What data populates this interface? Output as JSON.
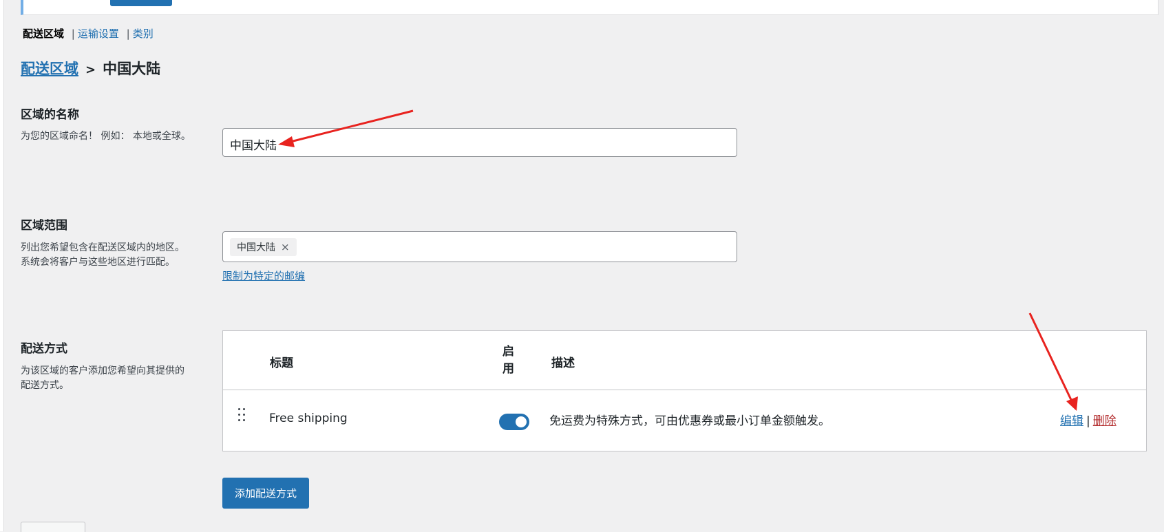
{
  "tabs": {
    "current": "配送区域",
    "separator": "|",
    "items": [
      "运输设置",
      "类别"
    ]
  },
  "breadcrumb": {
    "parent": "配送区域",
    "arrow": ">",
    "current": "中国大陆"
  },
  "zone_name": {
    "title": "区域的名称",
    "description": "为您的区域命名！ 例如： 本地或全球。",
    "value": "中国大陆"
  },
  "zone_regions": {
    "title": "区域范围",
    "description": "列出您希望包含在配送区域内的地区。 系统会将客户与这些地区进行匹配。",
    "chips": [
      "中国大陆"
    ],
    "remove_glyph": "×",
    "limit_link": "限制为特定的邮编"
  },
  "shipping_methods": {
    "title": "配送方式",
    "description": "为该区域的客户添加您希望向其提供的配送方式。",
    "columns": {
      "title": "标题",
      "enabled_line1": "启",
      "enabled_line2": "用",
      "description": "描述"
    },
    "rows": [
      {
        "title": "Free shipping",
        "enabled": true,
        "description": "免运费为特殊方式，可由优惠券或最小订单金额触发。",
        "edit": "编辑",
        "separator": "|",
        "delete": "删除"
      }
    ],
    "add_button": "添加配送方式"
  },
  "colors": {
    "link": "#2271b1",
    "primary": "#2271b1",
    "delete": "#b32d2e",
    "annotation": "#e8231f"
  }
}
